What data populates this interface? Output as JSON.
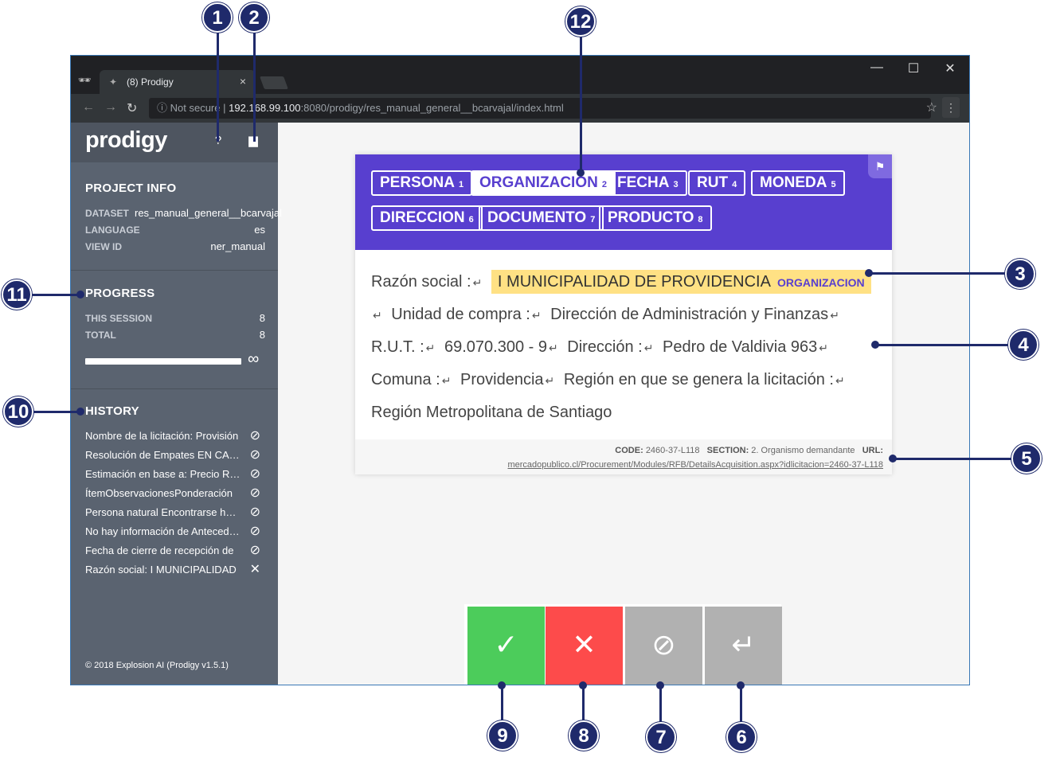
{
  "browser": {
    "tab_title": "(8) Prodigy",
    "tab_close": "×",
    "url_prefix": "Not secure",
    "url_host": "192.168.99.100",
    "url_rest": ":8080/prodigy/res_manual_general__bcarvajal/index.html",
    "minimize": "—",
    "maximize": "☐",
    "close": "✕"
  },
  "sidebar": {
    "logo": "prodigy",
    "project_info": {
      "heading": "PROJECT INFO",
      "dataset_key": "DATASET",
      "dataset_value": "res_manual_general__bcarvajal",
      "language_key": "LANGUAGE",
      "language_value": "es",
      "view_key": "VIEW ID",
      "view_value": "ner_manual"
    },
    "progress": {
      "heading": "PROGRESS",
      "session_key": "THIS SESSION",
      "session_value": "8",
      "total_key": "TOTAL",
      "total_value": "8",
      "fraction": 1.0,
      "infinity": "∞"
    },
    "history": {
      "heading": "HISTORY",
      "items": [
        {
          "text": "Nombre de la licitación: Provisión",
          "icon": "⊘"
        },
        {
          "text": "Resolución de Empates EN CASO DE",
          "icon": "⊘"
        },
        {
          "text": "Estimación en base a: Precio Referencial",
          "icon": "⊘"
        },
        {
          "text": "ÍtemObservacionesPonderación",
          "icon": "⊘"
        },
        {
          "text": "Persona natural Encontrarse hábil",
          "icon": "⊘"
        },
        {
          "text": "No hay información de Antecedentes",
          "icon": "⊘"
        },
        {
          "text": "Fecha de cierre de recepción de",
          "icon": "⊘"
        },
        {
          "text": "Razón social: I MUNICIPALIDAD",
          "icon": "✕"
        }
      ]
    },
    "footer": "© 2018 Explosion AI   (Prodigy v1.5.1)"
  },
  "labels": [
    {
      "name": "PERSONA",
      "key": "1"
    },
    {
      "name": "ORGANIZACION",
      "key": "2"
    },
    {
      "name": "FECHA",
      "key": "3"
    },
    {
      "name": "RUT",
      "key": "4"
    },
    {
      "name": "MONEDA",
      "key": "5"
    },
    {
      "name": "DIRECCION",
      "key": "6"
    },
    {
      "name": "DOCUMENTO",
      "key": "7"
    },
    {
      "name": "PRODUCTO",
      "key": "8"
    }
  ],
  "selected_label": "ORGANIZACION",
  "text": {
    "t1": "Razón social :",
    "entity_text": "I MUNICIPALIDAD DE PROVIDENCIA",
    "entity_label": "ORGANIZACION",
    "t2": "Unidad de compra :",
    "t3": "Dirección de Administración y Finanzas",
    "t4": "R.U.T. :",
    "t5": "69.070.300 - 9",
    "t6": "Dirección :",
    "t7": "Pedro de Valdivia 963",
    "t8": "Comuna :",
    "t9": "Providencia",
    "t10": "Región en que se genera la licitación :",
    "t11": "Región Metropolitana de Santiago",
    "return_symbol": "↵"
  },
  "meta": {
    "code_key": "CODE:",
    "code_value": "2460-37-L118",
    "section_key": "SECTION:",
    "section_value": "2. Organismo demandante",
    "url_key": "URL:",
    "url_value": "mercadopublico.cl/Procurement/Modules/RFB/DetailsAcquisition.aspx?idlicitacion=2460-37-L118"
  },
  "actions": {
    "accept": "✓",
    "reject": "✕",
    "ignore": "⊘",
    "undo": "↵",
    "colors": {
      "accept": "#4ccc5b",
      "reject": "#fd4b4b",
      "ignore": "#b1b1b1",
      "undo": "#b1b1b1"
    }
  },
  "callouts": [
    "1",
    "2",
    "3",
    "4",
    "5",
    "6",
    "7",
    "8",
    "9",
    "10",
    "11",
    "12"
  ],
  "colors": {
    "accent": "#583fcf",
    "sidebar": "#5a6370",
    "highlight": "#ffe184",
    "callout": "#1f2a6b"
  }
}
